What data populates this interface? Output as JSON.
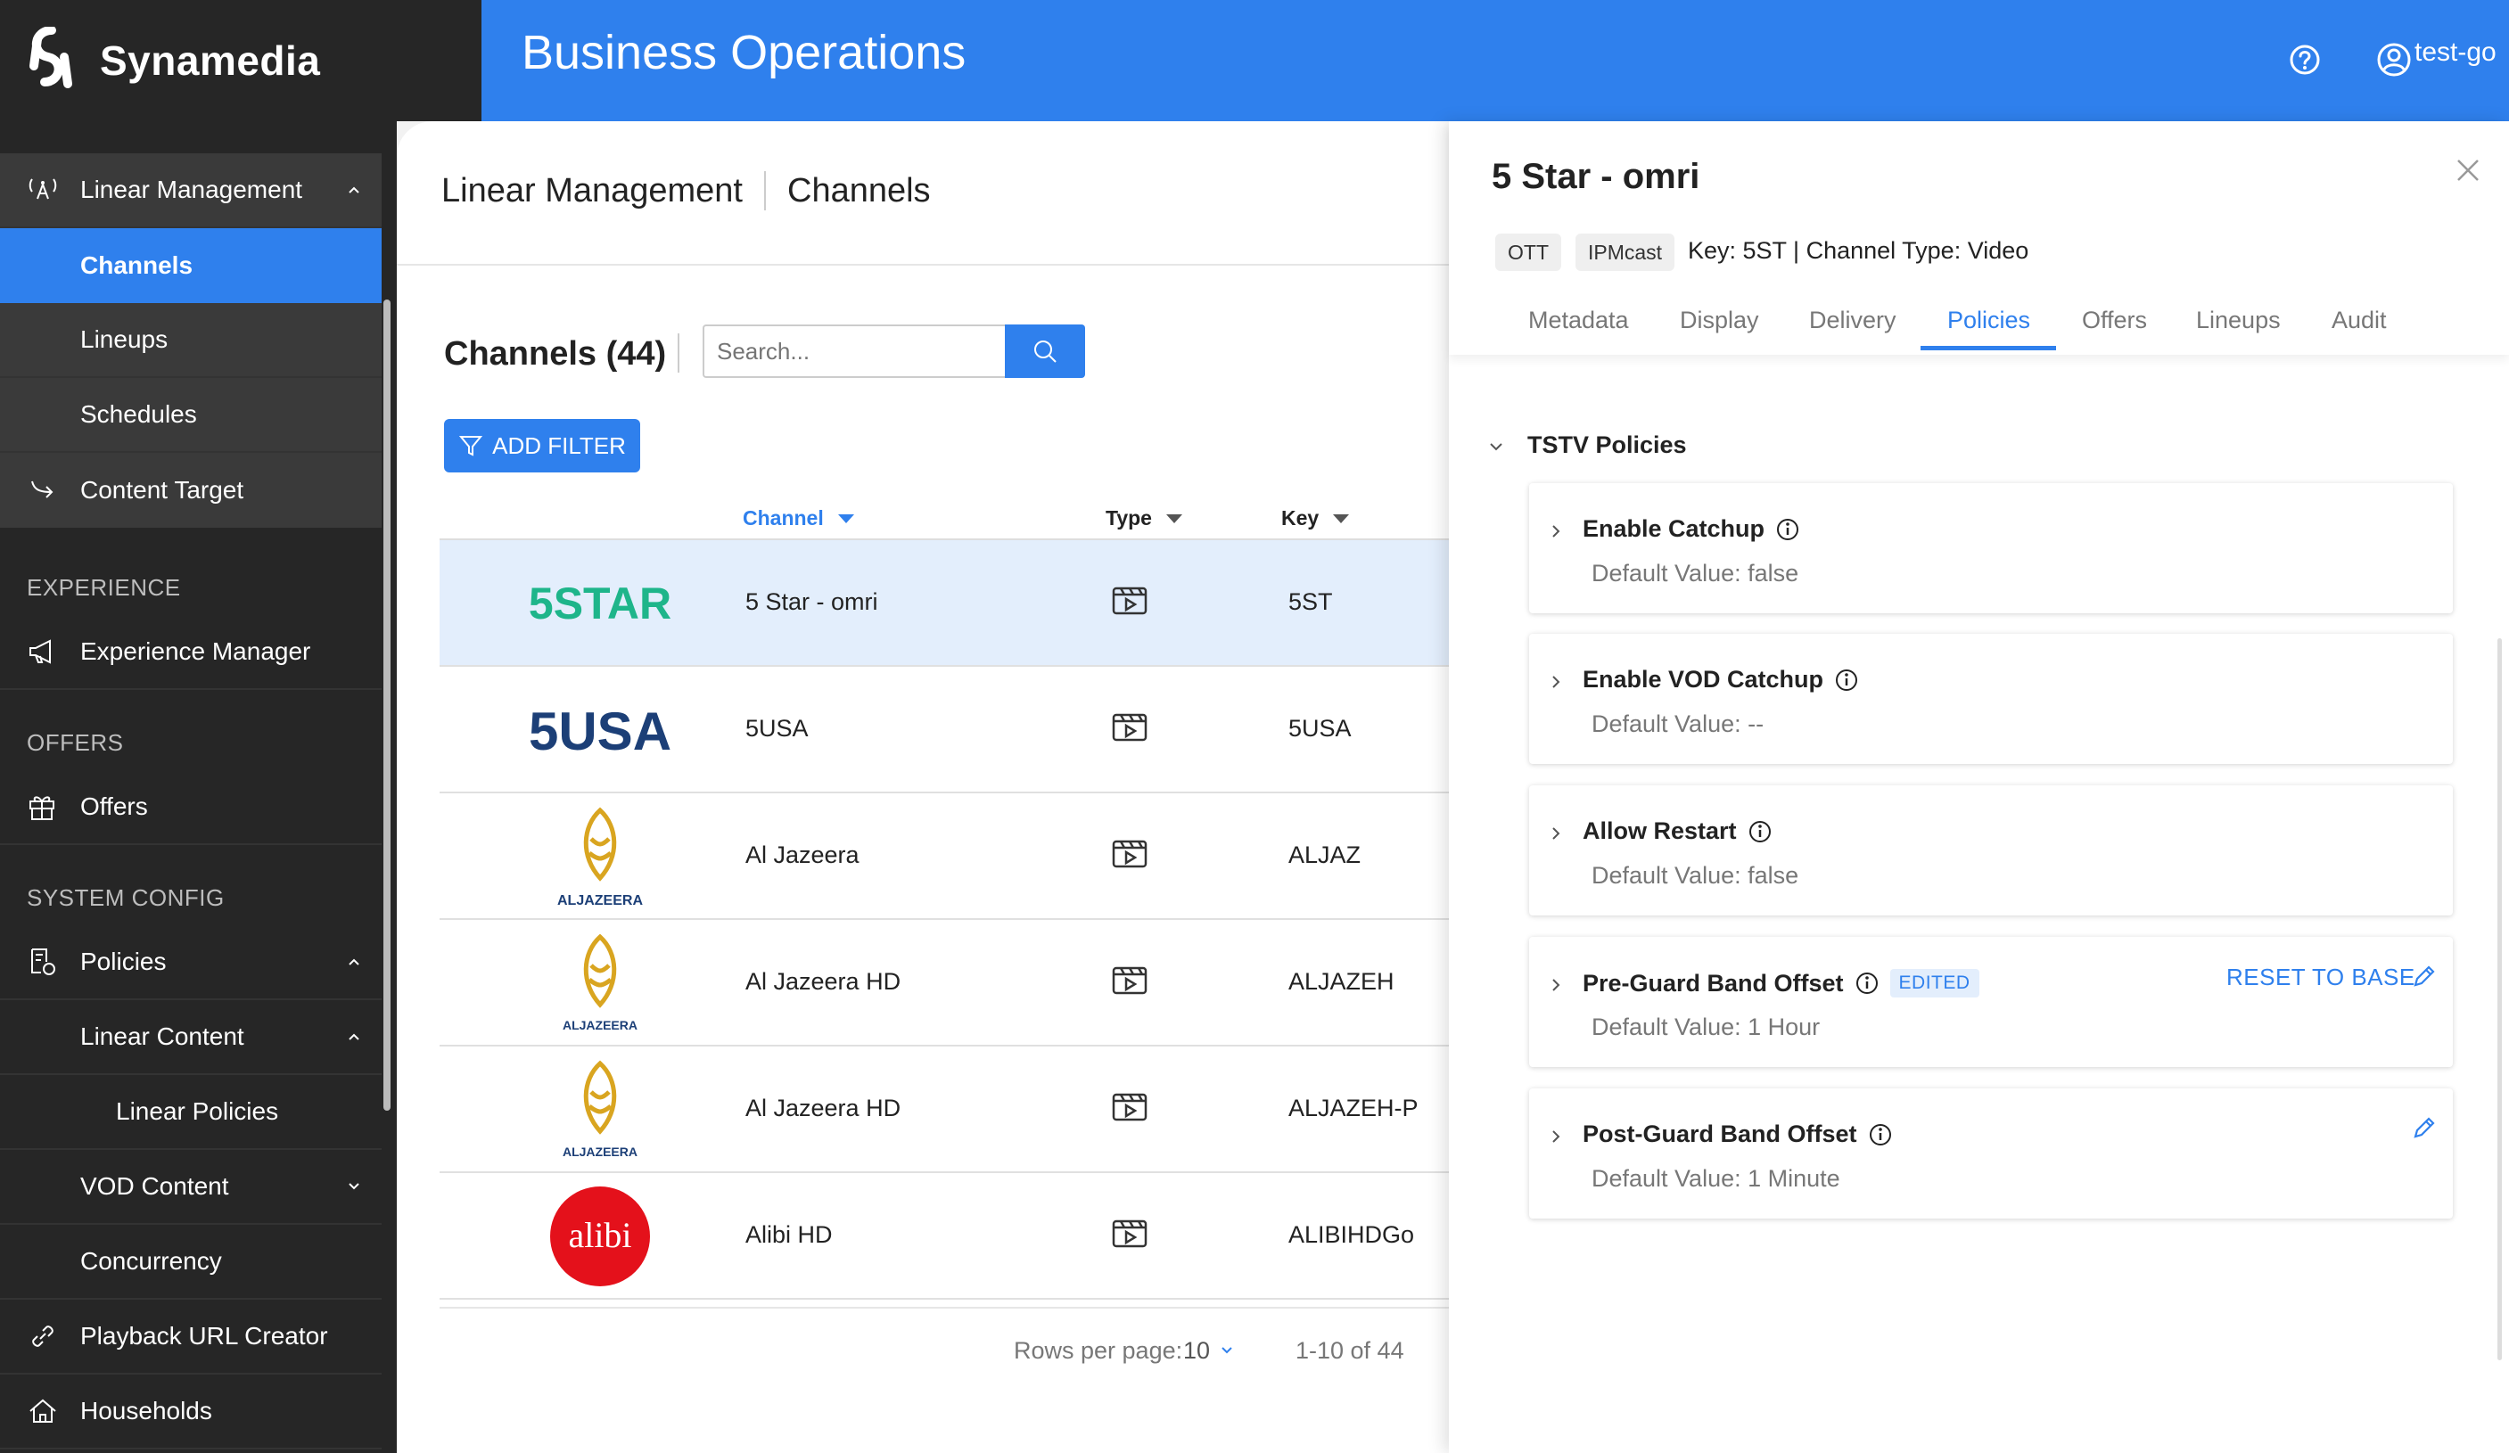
{
  "brand": {
    "name": "Synamedia"
  },
  "header": {
    "title": "Business Operations",
    "user": "test-go"
  },
  "sidebar": {
    "linear_management": "Linear Management",
    "channels": "Channels",
    "lineups": "Lineups",
    "schedules": "Schedules",
    "content_target": "Content Target",
    "section_experience": "EXPERIENCE",
    "experience_manager": "Experience Manager",
    "section_offers": "OFFERS",
    "offers": "Offers",
    "section_system": "SYSTEM CONFIG",
    "policies": "Policies",
    "linear_content": "Linear Content",
    "linear_policies": "Linear Policies",
    "vod_content": "VOD Content",
    "concurrency": "Concurrency",
    "playback_url": "Playback URL Creator",
    "households": "Households"
  },
  "breadcrumb": {
    "parent": "Linear Management",
    "current": "Channels"
  },
  "list": {
    "title": "Channels (44)",
    "search_placeholder": "Search...",
    "add_filter": "ADD FILTER",
    "columns": {
      "channel": "Channel",
      "type": "Type",
      "key": "Key"
    },
    "rows": [
      {
        "name": "5 Star - omri",
        "key": "5ST",
        "logo_text": "5STAR"
      },
      {
        "name": "5USA",
        "key": "5USA",
        "logo_text": "5USA"
      },
      {
        "name": "Al Jazeera",
        "key": "ALJAZ",
        "logo_text": "ALJAZEERA"
      },
      {
        "name": "Al Jazeera HD",
        "key": "ALJAZEH",
        "logo_text": "ALJAZEERA"
      },
      {
        "name": "Al Jazeera HD",
        "key": "ALJAZEH-P",
        "logo_text": "ALJAZEERA"
      },
      {
        "name": "Alibi HD",
        "key": "ALIBIHDGo",
        "logo_text": "alibi"
      }
    ],
    "pager": {
      "rows_label": "Rows per page:",
      "rows_value": "10",
      "range": "1-10 of 44"
    }
  },
  "drawer": {
    "title": "5 Star - omri",
    "chips": [
      "OTT",
      "IPMcast"
    ],
    "meta": "Key: 5ST |  Channel Type: Video",
    "tabs": [
      "Metadata",
      "Display",
      "Delivery",
      "Policies",
      "Offers",
      "Lineups",
      "Audit"
    ],
    "active_tab": "Policies",
    "section": "TSTV Policies",
    "policies": [
      {
        "title": "Enable Catchup",
        "default": "Default Value: false"
      },
      {
        "title": "Enable VOD Catchup",
        "default": "Default Value: --"
      },
      {
        "title": "Allow Restart",
        "default": "Default Value: false"
      },
      {
        "title": "Pre-Guard Band Offset",
        "default": "Default Value: 1 Hour",
        "badge": "EDITED",
        "action": "RESET TO BASE"
      },
      {
        "title": "Post-Guard Band Offset",
        "default": "Default Value: 1 Minute"
      }
    ]
  },
  "colors": {
    "accent": "#2f80ed",
    "sidebar": "#262626",
    "sidebar_sub": "#3a3a3a"
  }
}
